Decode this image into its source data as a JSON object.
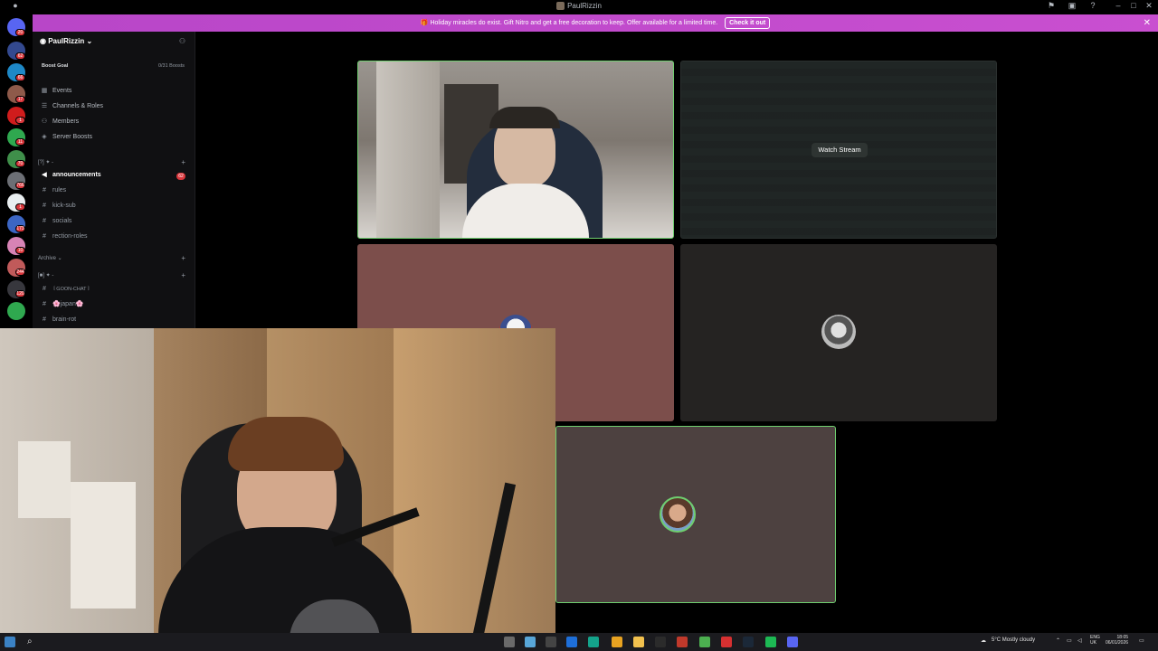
{
  "window": {
    "title": "PaulRizzin"
  },
  "banner": {
    "text": "Holiday miracles do exist. Gift Nitro and get a free decoration to keep. Offer available for a limited time.",
    "cta": "Check it out"
  },
  "rail_badges": [
    "20",
    "62",
    "66",
    "17",
    "1",
    "11",
    "70",
    "766",
    "1",
    "173",
    "10",
    "244",
    "120"
  ],
  "server": {
    "name": "PaulRizzin",
    "boost_goal_label": "Boost Goal",
    "boost_progress": "0/31 Boosts"
  },
  "menu": [
    {
      "label": "Events",
      "icon": "calendar-icon"
    },
    {
      "label": "Channels & Roles",
      "icon": "list-icon"
    },
    {
      "label": "Members",
      "icon": "members-icon"
    },
    {
      "label": "Server Boosts",
      "icon": "boost-icon"
    }
  ],
  "categories": {
    "first": "[?] ✦ -",
    "archive": "Archive",
    "third": "[■] ✦ -"
  },
  "channels": [
    {
      "name": "announcements",
      "badge": "62",
      "bold": true
    },
    {
      "name": "rules"
    },
    {
      "name": "kick-sub"
    },
    {
      "name": "socials"
    },
    {
      "name": "rection-roles"
    }
  ],
  "archive_channels": [
    {
      "name": "꒰GOON-CHAT꒱"
    },
    {
      "name": "🌸japan🌸"
    },
    {
      "name": "brain-rot"
    }
  ],
  "stage": {
    "watch_stream": "Watch Stream"
  },
  "taskbar": {
    "weather": "5°C  Mostly cloudy",
    "lang": "ENG",
    "region": "UK",
    "time": "18:05",
    "date": "06/01/2026"
  },
  "colors": {
    "banner": "#c94fd0",
    "speaking_border": "#6fcf6f",
    "tile_pink": "#7c4e4b",
    "tile_grey": "#252322",
    "tile_brown": "#4d4140"
  }
}
